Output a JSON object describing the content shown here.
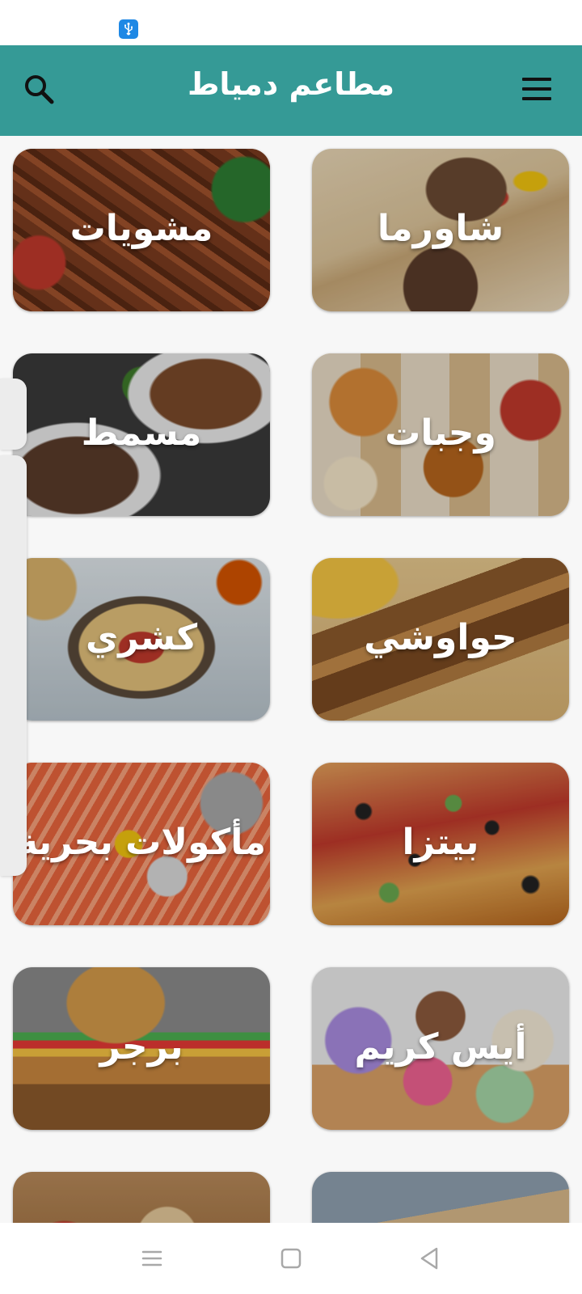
{
  "status_bar": {
    "icon": "usb-icon"
  },
  "app_bar": {
    "title": "مطاعم دمياط",
    "search_icon": "search-icon",
    "menu_icon": "menu-icon"
  },
  "categories": [
    {
      "label": "شاورما",
      "image": "shawarma-image"
    },
    {
      "label": "مشويات",
      "image": "grills-image"
    },
    {
      "label": "وجبات",
      "image": "meals-image"
    },
    {
      "label": "مسمط",
      "image": "masmat-image"
    },
    {
      "label": "حواوشي",
      "image": "hawawshi-image"
    },
    {
      "label": "كشري",
      "image": "koshary-image"
    },
    {
      "label": "بيتزا",
      "image": "pizza-image"
    },
    {
      "label": "مأكولات بحرية",
      "image": "seafood-image"
    },
    {
      "label": "أيس كريم",
      "image": "ice-cream-image"
    },
    {
      "label": "برجر",
      "image": "burger-image"
    },
    {
      "label": "",
      "image": "wrap-image"
    },
    {
      "label": "",
      "image": "mezze-image"
    }
  ],
  "nav_bar": {
    "recents_icon": "recents-icon",
    "home_icon": "home-icon",
    "back_icon": "back-icon"
  },
  "colors": {
    "app_bar": "#359a96",
    "title_text": "#ffffff",
    "background": "#f7f7f7"
  }
}
